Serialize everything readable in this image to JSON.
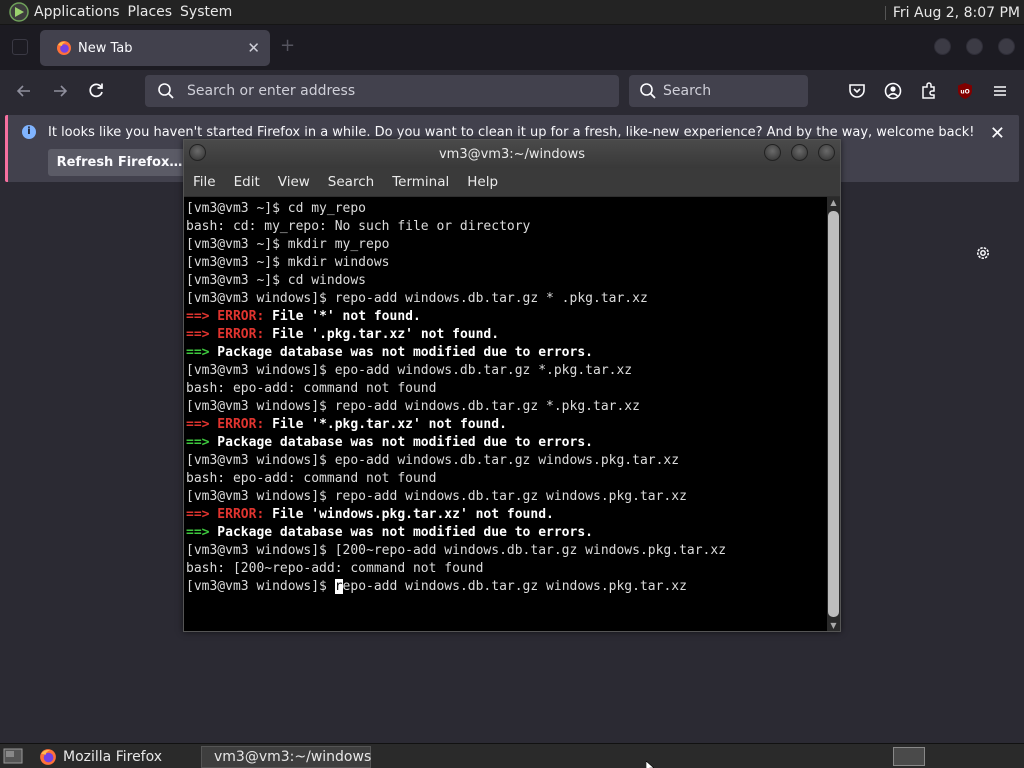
{
  "panel": {
    "applications": "Applications",
    "places": "Places",
    "system": "System",
    "clock": "Fri Aug  2,  8:07 PM"
  },
  "firefox": {
    "tab_title": "New Tab",
    "url_placeholder": "Search or enter address",
    "search_placeholder": "Search",
    "notification": "It looks like you haven't started Firefox in a while. Do you want to clean it up for a fresh, like-new experience? And by the way, welcome back!",
    "refresh_button": "Refresh Firefox…"
  },
  "terminal": {
    "title": "vm3@vm3:~/windows",
    "menu": [
      "File",
      "Edit",
      "View",
      "Search",
      "Terminal",
      "Help"
    ],
    "lines": [
      {
        "parts": [
          {
            "t": "[vm3@vm3 ~]$ cd my_repo",
            "c": ""
          }
        ]
      },
      {
        "parts": [
          {
            "t": "bash: cd: my_repo: No such file or directory",
            "c": ""
          }
        ]
      },
      {
        "parts": [
          {
            "t": "[vm3@vm3 ~]$ mkdir my_repo",
            "c": ""
          }
        ]
      },
      {
        "parts": [
          {
            "t": "[vm3@vm3 ~]$ mkdir windows",
            "c": ""
          }
        ]
      },
      {
        "parts": [
          {
            "t": "[vm3@vm3 ~]$ cd windows",
            "c": ""
          }
        ]
      },
      {
        "parts": [
          {
            "t": "[vm3@vm3 windows]$ repo-add windows.db.tar.gz * .pkg.tar.xz",
            "c": ""
          }
        ]
      },
      {
        "parts": [
          {
            "t": "==> ERROR:",
            "c": "red"
          },
          {
            "t": " File '*' not found.",
            "c": "bw"
          }
        ]
      },
      {
        "parts": [
          {
            "t": "==> ERROR:",
            "c": "red"
          },
          {
            "t": " File '.pkg.tar.xz' not found.",
            "c": "bw"
          }
        ]
      },
      {
        "parts": [
          {
            "t": "==>",
            "c": "grn"
          },
          {
            "t": " Package database was not modified due to errors.",
            "c": "bw"
          }
        ]
      },
      {
        "parts": [
          {
            "t": "[vm3@vm3 windows]$ epo-add windows.db.tar.gz *.pkg.tar.xz",
            "c": ""
          }
        ]
      },
      {
        "parts": [
          {
            "t": "bash: epo-add: command not found",
            "c": ""
          }
        ]
      },
      {
        "parts": [
          {
            "t": "[vm3@vm3 windows]$ repo-add windows.db.tar.gz *.pkg.tar.xz",
            "c": ""
          }
        ]
      },
      {
        "parts": [
          {
            "t": "==> ERROR:",
            "c": "red"
          },
          {
            "t": " File '*.pkg.tar.xz' not found.",
            "c": "bw"
          }
        ]
      },
      {
        "parts": [
          {
            "t": "==>",
            "c": "grn"
          },
          {
            "t": " Package database was not modified due to errors.",
            "c": "bw"
          }
        ]
      },
      {
        "parts": [
          {
            "t": "[vm3@vm3 windows]$ epo-add windows.db.tar.gz windows.pkg.tar.xz",
            "c": ""
          }
        ]
      },
      {
        "parts": [
          {
            "t": "bash: epo-add: command not found",
            "c": ""
          }
        ]
      },
      {
        "parts": [
          {
            "t": "[vm3@vm3 windows]$ repo-add windows.db.tar.gz windows.pkg.tar.xz",
            "c": ""
          }
        ]
      },
      {
        "parts": [
          {
            "t": "==> ERROR:",
            "c": "red"
          },
          {
            "t": " File 'windows.pkg.tar.xz' not found.",
            "c": "bw"
          }
        ]
      },
      {
        "parts": [
          {
            "t": "==>",
            "c": "grn"
          },
          {
            "t": " Package database was not modified due to errors.",
            "c": "bw"
          }
        ]
      },
      {
        "parts": [
          {
            "t": "[vm3@vm3 windows]$ [200~repo-add windows.db.tar.gz windows.pkg.tar.xz",
            "c": ""
          }
        ]
      },
      {
        "parts": [
          {
            "t": "bash: [200~repo-add: command not found",
            "c": ""
          }
        ]
      },
      {
        "parts": [
          {
            "t": "[vm3@vm3 windows]$ ",
            "c": ""
          },
          {
            "t": "r",
            "c": "cursor"
          },
          {
            "t": "epo-add windows.db.tar.gz windows.pkg.tar.xz",
            "c": ""
          }
        ]
      }
    ]
  },
  "taskbar": {
    "firefox": "Mozilla Firefox",
    "terminal": "vm3@vm3:~/windows"
  }
}
